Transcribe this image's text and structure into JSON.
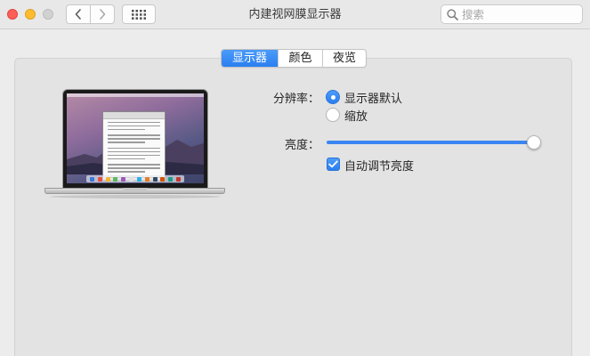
{
  "window": {
    "title": "内建视网膜显示器"
  },
  "titlebar": {
    "back_icon": "chevron-left-icon",
    "forward_icon": "chevron-right-icon",
    "show_all_icon": "grid-icon"
  },
  "search": {
    "placeholder": "搜索",
    "value": ""
  },
  "tabs": [
    {
      "label": "显示器",
      "active": true
    },
    {
      "label": "颜色",
      "active": false
    },
    {
      "label": "夜览",
      "active": false
    }
  ],
  "resolution": {
    "label": "分辨率：",
    "options": [
      {
        "label": "显示器默认",
        "selected": true
      },
      {
        "label": "缩放",
        "selected": false
      }
    ]
  },
  "brightness": {
    "label": "亮度：",
    "level": 1.0,
    "auto_adjust_label": "自动调节亮度",
    "auto_adjust_checked": true
  },
  "colors": {
    "accent": "#2a7ff0",
    "close": "#fe5f57",
    "minimize": "#febc2e"
  }
}
